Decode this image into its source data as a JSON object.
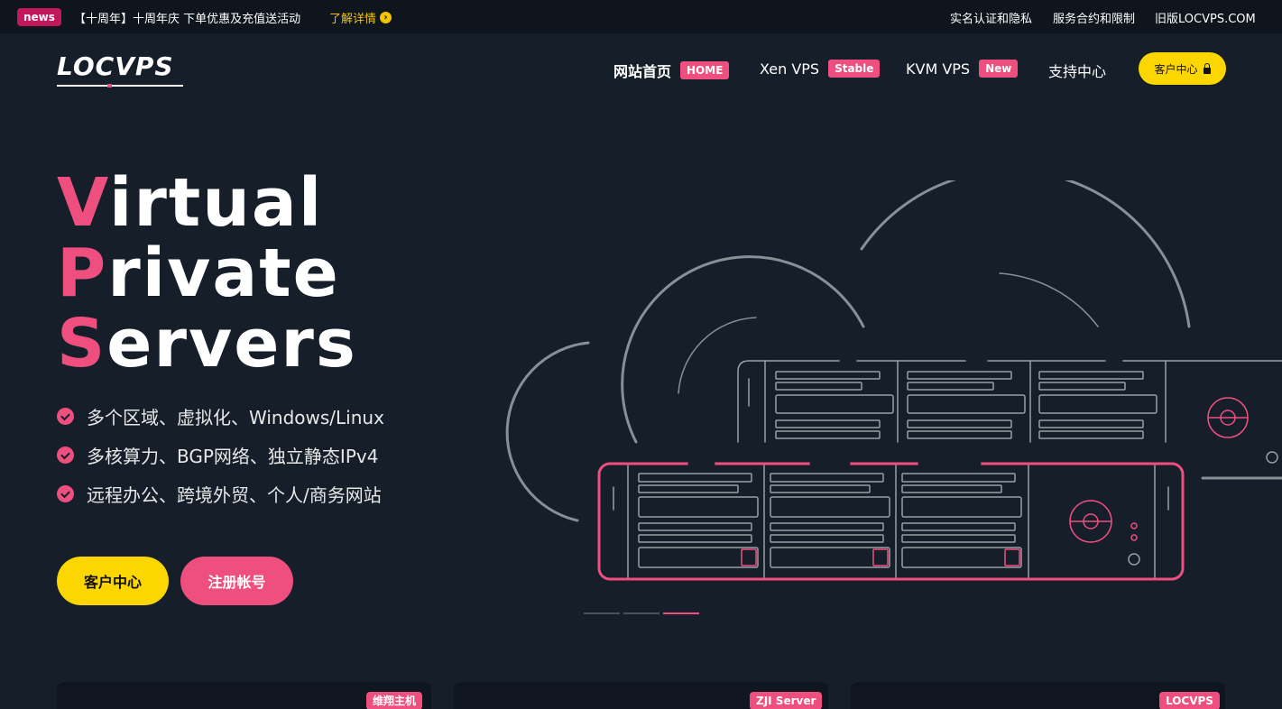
{
  "topbar": {
    "news_badge": "news",
    "news_text": "【十周年】十周年庆 下单优惠及充值送活动",
    "news_link": "了解详情",
    "links": [
      "实名认证和隐私",
      "服务合约和限制",
      "旧版LOCVPS.COM"
    ]
  },
  "logo": "LOCVPS",
  "nav": {
    "items": [
      {
        "label": "网站首页",
        "badge": "HOME"
      },
      {
        "label": "Xen VPS",
        "badge": "Stable"
      },
      {
        "label": "KVM VPS",
        "badge": "New"
      },
      {
        "label": "支持中心",
        "badge": ""
      }
    ],
    "client_button": "客户中心"
  },
  "hero": {
    "lines": [
      {
        "first": "V",
        "rest": "irtual"
      },
      {
        "first": "P",
        "rest": "rivate"
      },
      {
        "first": "S",
        "rest": "ervers"
      }
    ],
    "features": [
      "多个区域、虚拟化、Windows/Linux",
      "多核算力、BGP网络、独立静态IPv4",
      "远程办公、跨境外贸、个人/商务网站"
    ],
    "buttons": {
      "primary": "客户中心",
      "secondary": "注册帐号"
    }
  },
  "carousel": {
    "slides": 3,
    "active": 3
  },
  "cards": [
    {
      "badge": "维翔主机"
    },
    {
      "badge": "ZJI Server"
    },
    {
      "badge": "LOCVPS"
    }
  ],
  "colors": {
    "accent": "#ef4f7f",
    "yellow": "#fcd600",
    "background": "#151e29"
  }
}
